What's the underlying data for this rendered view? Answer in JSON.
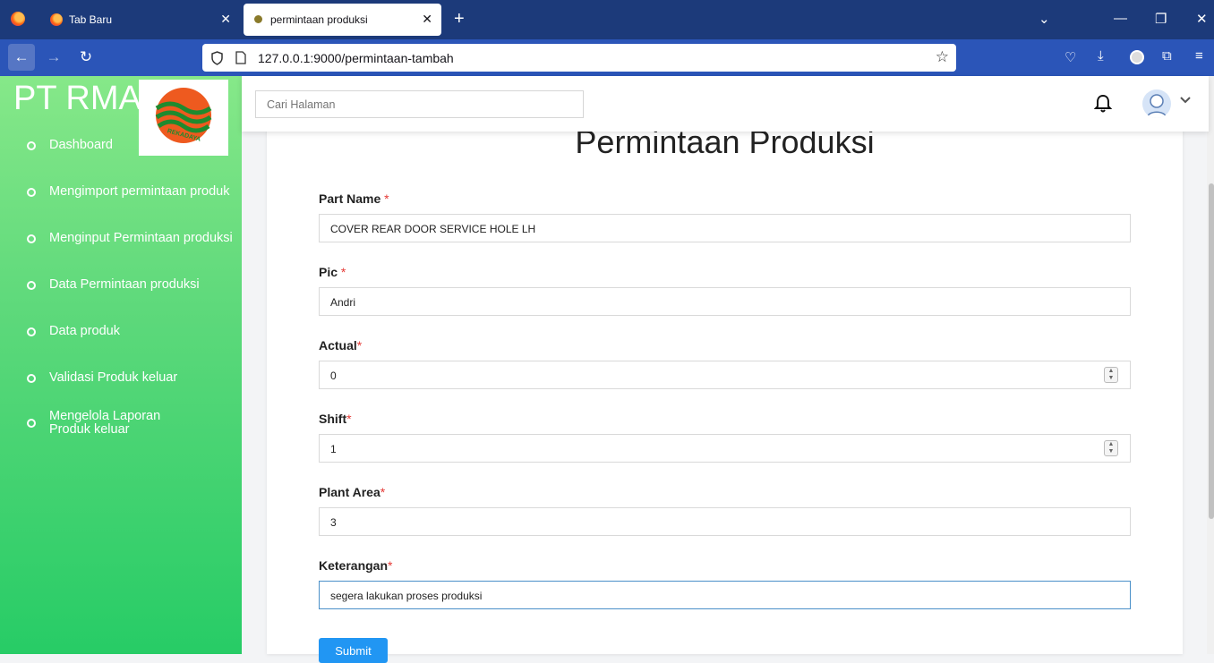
{
  "browser": {
    "tabs": [
      {
        "title": "Tab Baru",
        "active": false
      },
      {
        "title": "permintaan produksi",
        "active": true
      }
    ],
    "url": "127.0.0.1:9000/permintaan-tambah"
  },
  "sidebar": {
    "brand": "PT RMA",
    "logo_text": "REKADAYA",
    "items": [
      {
        "label": "Dashboard"
      },
      {
        "label": "Mengimport permintaan produk"
      },
      {
        "label": "Menginput Permintaan produksi"
      },
      {
        "label": "Data Permintaan produksi"
      },
      {
        "label": "Data produk"
      },
      {
        "label": "Validasi Produk keluar"
      },
      {
        "label": "Mengelola Laporan Produk keluar"
      }
    ]
  },
  "topbar": {
    "search_placeholder": "Cari Halaman"
  },
  "form": {
    "title": "Permintaan Produksi",
    "required_mark": "*",
    "fields": [
      {
        "label": "Part Name",
        "value": "COVER REAR DOOR SERVICE HOLE LH"
      },
      {
        "label": "Pic",
        "value": "Andri"
      },
      {
        "label": "Actual",
        "value": "0"
      },
      {
        "label": "Shift",
        "value": "1"
      },
      {
        "label": "Plant Area",
        "value": "3"
      },
      {
        "label": "Keterangan",
        "value": "segera lakukan proses produksi"
      }
    ],
    "submit_label": "Submit"
  },
  "colors": {
    "sidebar_top": "#86e889",
    "sidebar_bottom": "#27cc66",
    "submit": "#2196f3",
    "browser_tabbar": "#1c3a7a",
    "browser_navbar": "#2b55b8"
  }
}
